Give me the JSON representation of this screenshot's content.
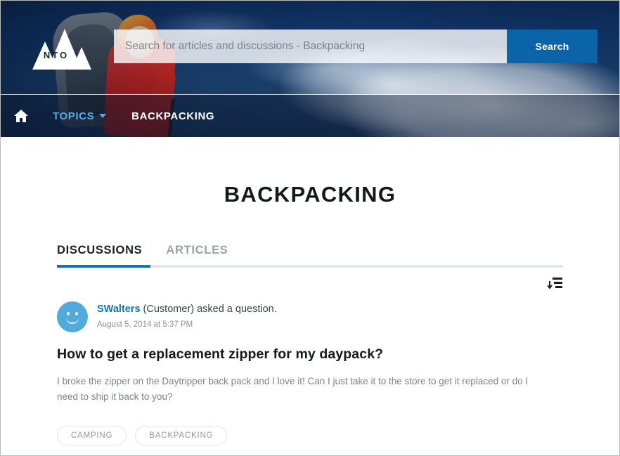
{
  "brand": {
    "logo_text": "NTO",
    "logo_icon": "mountain-logo-icon"
  },
  "search": {
    "placeholder": "Search for articles and discussions - Backpacking",
    "value": "",
    "button_label": "Search",
    "button_color": "#0b63a8"
  },
  "nav": {
    "home_icon": "home-icon",
    "topics_label": "TOPICS",
    "topics_caret_icon": "chevron-down-icon",
    "current_label": "BACKPACKING",
    "topics_color": "#57a9e8",
    "current_color": "#ffffff"
  },
  "main": {
    "page_title": "BACKPACKING",
    "tabs": [
      {
        "label": "DISCUSSIONS",
        "active": true
      },
      {
        "label": "ARTICLES",
        "active": false
      }
    ],
    "active_tab_color": "#1273ba",
    "sort_icon": "sort-descending-icon"
  },
  "post": {
    "avatar_icon": "smiley-avatar-icon",
    "author": "SWalters",
    "author_color": "#1273ba",
    "meta_suffix": "(Customer) asked a question.",
    "timestamp": "August 5, 2014 at 5:37 PM",
    "title": "How to get a replacement zipper for my daypack?",
    "body": "I broke the zipper on the Daytripper back pack and I love it! Can I just take it to the store to get it replaced or do I need to ship it back to you?",
    "tags": [
      "CAMPING",
      "BACKPACKING"
    ]
  }
}
